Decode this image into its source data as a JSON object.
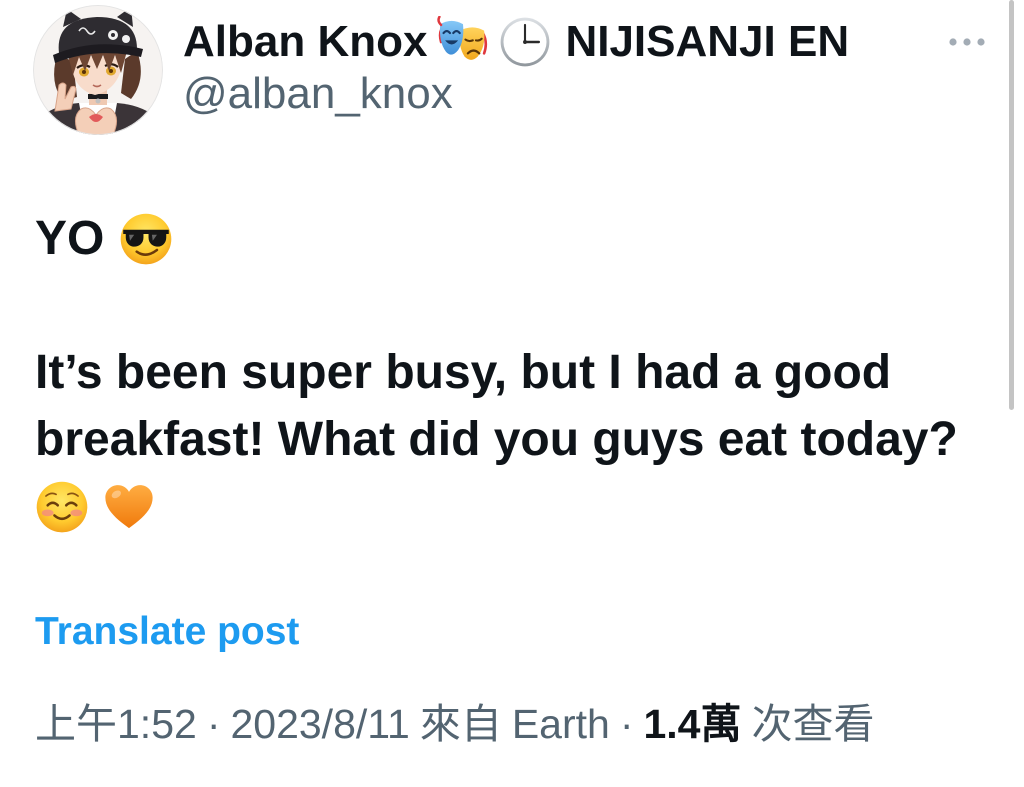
{
  "colors": {
    "background": "#ffffff",
    "text": "#0f1419",
    "secondary": "#536471",
    "link": "#1d9bf0"
  },
  "author": {
    "avatar_icon": "avatar-image",
    "name": "Alban Knox",
    "name_emojis": [
      "performing-arts-emoji",
      "three-oclock-emoji"
    ],
    "affiliation": "NIJISANJI EN",
    "handle": "@alban_knox"
  },
  "header": {
    "more_icon": "more-horizontal-icon"
  },
  "post": {
    "greeting": "YO",
    "greeting_emoji": "smiling-face-with-sunglasses-emoji",
    "body_lines": [
      "It’s been super busy, but I had a good",
      "breakfast! What did you guys eat today?"
    ],
    "closing_emojis": [
      "smiling-face-emoji",
      "orange-heart-emoji"
    ]
  },
  "translate": {
    "label": "Translate post"
  },
  "meta": {
    "time": "上午1:52",
    "separator": "·",
    "date": "2023/8/11",
    "source_prefix": "來自",
    "source": "Earth",
    "view_count": "1.4萬",
    "view_label": "次查看"
  }
}
